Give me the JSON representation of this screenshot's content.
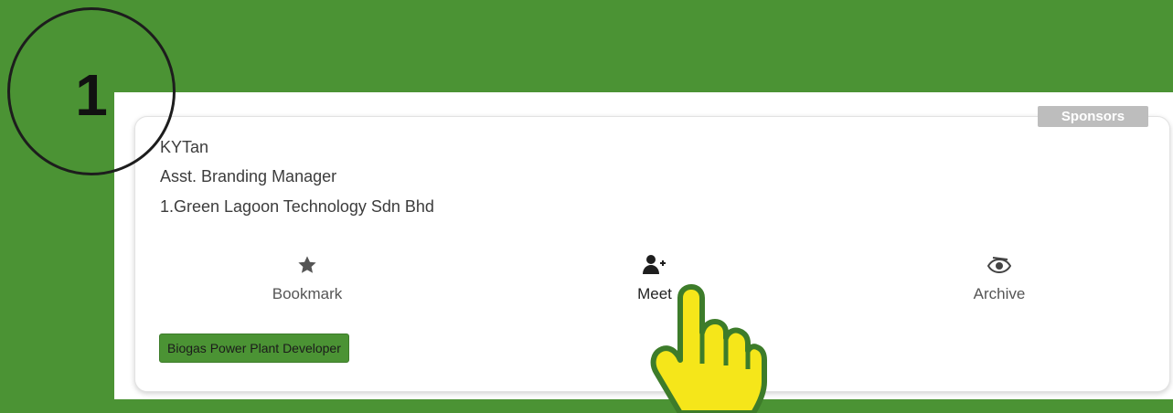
{
  "step": {
    "number": "1"
  },
  "card": {
    "badge": "Sponsors",
    "name": "KYTan",
    "title": "Asst. Branding Manager",
    "company": "1.Green Lagoon Technology Sdn Bhd",
    "actions": [
      {
        "label": "Bookmark",
        "icon": "star-icon"
      },
      {
        "label": "Meet",
        "icon": "add-user-icon"
      },
      {
        "label": "Archive",
        "icon": "eye-slash-icon"
      }
    ],
    "tag": "Biogas Power Plant Developer"
  },
  "colors": {
    "background": "#4b9334",
    "badge": "#bdbdbd",
    "tag": "#4b9334",
    "pointer_hand": "#f5e61a"
  }
}
